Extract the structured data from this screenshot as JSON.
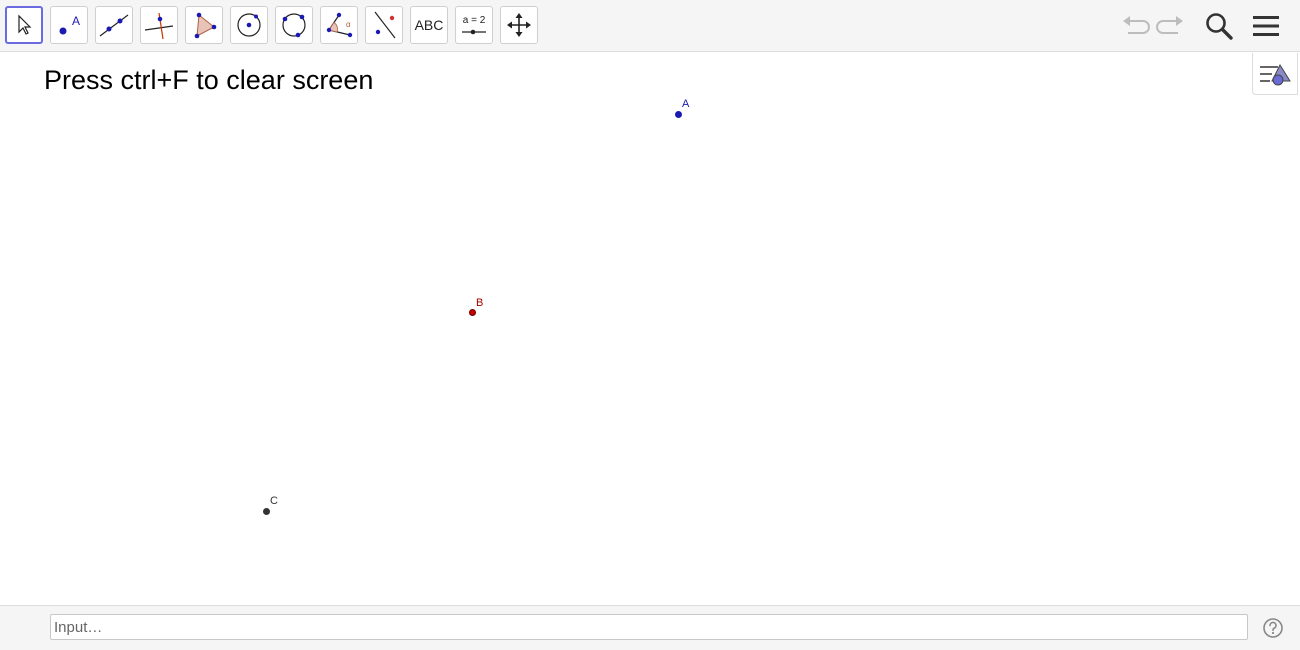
{
  "toolbar": {
    "tools": [
      {
        "name": "move-tool",
        "icon": "cursor-arrow-icon",
        "selected": true
      },
      {
        "name": "point-tool",
        "icon": "point-icon",
        "icon_label": "A"
      },
      {
        "name": "line-tool",
        "icon": "line-through-points-icon"
      },
      {
        "name": "perpendicular-line-tool",
        "icon": "perpendicular-line-icon"
      },
      {
        "name": "polygon-tool",
        "icon": "polygon-icon"
      },
      {
        "name": "circle-tool",
        "icon": "circle-center-point-icon"
      },
      {
        "name": "circle-three-points-tool",
        "icon": "circle-three-points-icon"
      },
      {
        "name": "angle-tool",
        "icon": "angle-icon",
        "icon_label": "α"
      },
      {
        "name": "reflect-tool",
        "icon": "reflect-about-line-icon"
      },
      {
        "name": "text-tool",
        "icon": "text-icon",
        "label": "ABC"
      },
      {
        "name": "slider-tool",
        "icon": "slider-icon",
        "label": "a = 2"
      },
      {
        "name": "move-graphics-view-tool",
        "icon": "move-arrows-icon"
      }
    ],
    "right": {
      "undo_icon": "undo-icon",
      "redo_icon": "redo-icon",
      "search_icon": "search-icon",
      "menu_icon": "hamburger-menu-icon"
    }
  },
  "graphics": {
    "hint_text": "Press ctrl+F to clear screen",
    "style_bar_icon": "style-bar-toggle-icon",
    "points": [
      {
        "label": "A",
        "color": "#1a1ab3"
      },
      {
        "label": "B",
        "color": "#cc0000",
        "stroke": "#660000"
      },
      {
        "label": "C",
        "color": "#333333"
      }
    ]
  },
  "input_bar": {
    "placeholder": "Input…",
    "value": "",
    "help_icon": "help-circle-icon"
  },
  "colors": {
    "accent": "#6b6be0",
    "point_blue": "#1a1ab3",
    "point_red": "#cc0000",
    "point_black": "#333333",
    "toolbar_bg": "#f5f5f5"
  }
}
